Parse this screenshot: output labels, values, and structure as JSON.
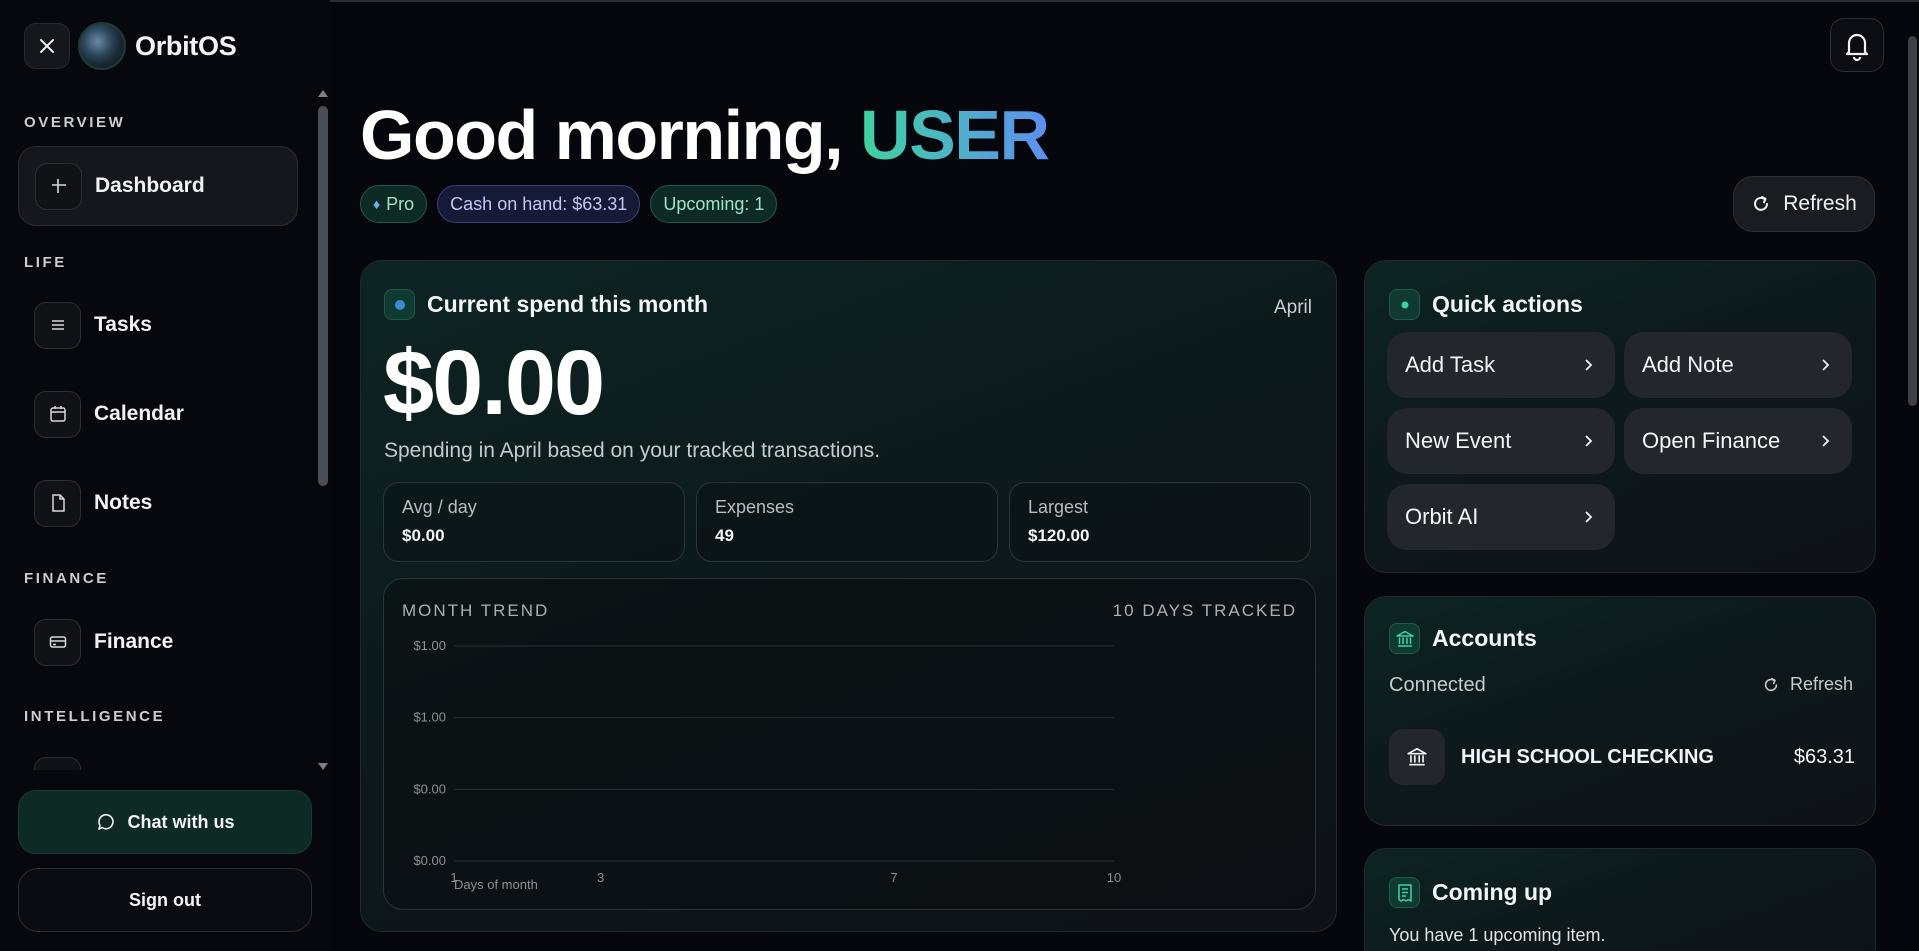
{
  "app": {
    "name": "OrbitOS"
  },
  "sidebar": {
    "sections": {
      "overview": "OVERVIEW",
      "life": "LIFE",
      "finance": "FINANCE",
      "intelligence": "INTELLIGENCE"
    },
    "items": {
      "dashboard": "Dashboard",
      "tasks": "Tasks",
      "calendar": "Calendar",
      "notes": "Notes",
      "finance": "Finance"
    },
    "chat_label": "Chat with us",
    "signout_label": "Sign out"
  },
  "header": {
    "greeting": "Good morning,",
    "user_name": "USER",
    "chips": {
      "plan": "Pro",
      "cash": "Cash on hand: $63.31",
      "upcoming": "Upcoming: 1"
    },
    "refresh_label": "Refresh"
  },
  "spend": {
    "title": "Current spend this month",
    "month": "April",
    "amount": "$0.00",
    "description": "Spending in April based on your tracked transactions.",
    "stats": {
      "avg_label": "Avg / day",
      "avg_value": "$0.00",
      "expenses_label": "Expenses",
      "expenses_value": "49",
      "largest_label": "Largest",
      "largest_value": "$120.00"
    },
    "trend_label": "MONTH TREND",
    "trend_right": "10 DAYS TRACKED"
  },
  "chart_data": {
    "type": "line",
    "xlabel": "Days of month",
    "ylabel": "",
    "y_tick_labels": [
      "$1.00",
      "$1.00",
      "$0.00",
      "$0.00"
    ],
    "x_ticks": [
      1,
      3,
      7,
      10
    ],
    "ylim": [
      0,
      1
    ],
    "series": [],
    "grid": true
  },
  "quick_actions": {
    "title": "Quick actions",
    "add_task": "Add Task",
    "add_note": "Add Note",
    "new_event": "New Event",
    "open_finance": "Open Finance",
    "orbit_ai": "Orbit AI"
  },
  "accounts": {
    "title": "Accounts",
    "status": "Connected",
    "refresh_label": "Refresh",
    "items": [
      {
        "name": "HIGH SCHOOL CHECKING",
        "balance": "$63.31"
      }
    ]
  },
  "coming_up": {
    "title": "Coming up",
    "text": "You have 1 upcoming item."
  },
  "colors": {
    "accent_green": "#3fd3a0",
    "accent_blue": "#5d8ff0",
    "background": "#06070c"
  }
}
